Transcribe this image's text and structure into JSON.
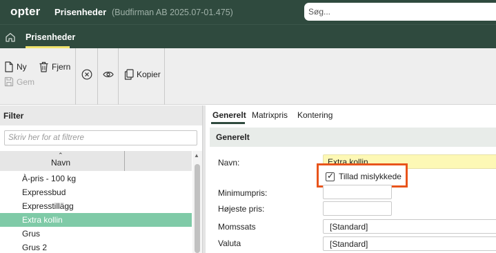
{
  "header": {
    "logo": "opter",
    "app_title": "Prisenheder",
    "app_subtitle": "(Budfirman AB 2025.07-01.475)",
    "search_placeholder": "Søg..."
  },
  "nav": {
    "tab_label": "Prisenheder"
  },
  "toolbar": {
    "new_label": "Ny",
    "remove_label": "Fjern",
    "save_label": "Gem",
    "copy_label": "Kopier"
  },
  "filter": {
    "title": "Filter",
    "placeholder": "Skriv her for at filtrere",
    "column_name": "Navn",
    "items": [
      {
        "label": "À-pris - 100 kg"
      },
      {
        "label": "Expressbud"
      },
      {
        "label": "Expresstillägg"
      },
      {
        "label": "Extra kollin"
      },
      {
        "label": "Grus"
      },
      {
        "label": "Grus 2"
      }
    ],
    "selected_index": 3
  },
  "detail": {
    "tabs": [
      {
        "label": "Generelt"
      },
      {
        "label": "Matrixpris"
      },
      {
        "label": "Kontering"
      }
    ],
    "section_title": "Generelt",
    "fields": {
      "name_label": "Navn:",
      "name_value": "Extra kollin",
      "allow_broken_label": "Tillad mislykkede",
      "allow_broken_checked": true,
      "min_price_label": "Minimumpris:",
      "min_price_value": "",
      "max_price_label": "Højeste pris:",
      "max_price_value": "",
      "vat_label": "Momssats",
      "vat_value": "[Standard]",
      "currency_label": "Valuta",
      "currency_value": "[Standard]"
    }
  },
  "colors": {
    "header_bg": "#2f4a3e",
    "accent_yellow": "#f0e36d",
    "selected_row": "#7fcaa7",
    "highlight": "#e8541b",
    "required_field": "#fdf8b5"
  }
}
